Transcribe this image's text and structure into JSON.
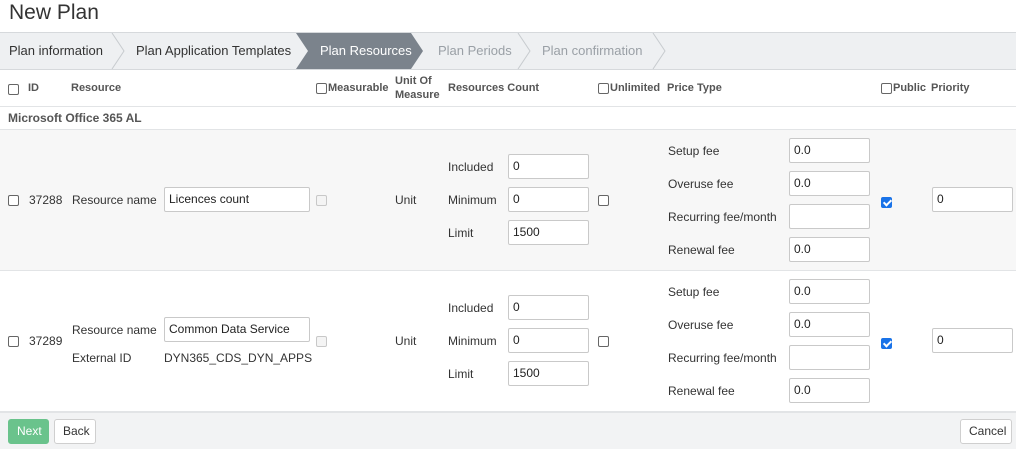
{
  "page": {
    "title": "New Plan"
  },
  "wizard": {
    "steps": [
      {
        "label": "Plan information",
        "state": "done"
      },
      {
        "label": "Plan Application Templates",
        "state": "done"
      },
      {
        "label": "Plan Resources",
        "state": "active"
      },
      {
        "label": "Plan Periods",
        "state": "future"
      },
      {
        "label": "Plan confirmation",
        "state": "future"
      }
    ]
  },
  "table": {
    "headers": {
      "id": "ID",
      "resource": "Resource",
      "measurable": "Measurable",
      "unit_of_measure_line1": "Unit Of",
      "unit_of_measure_line2": "Measure",
      "resources_count": "Resources Count",
      "unlimited": "Unlimited",
      "price_type": "Price Type",
      "public": "Public",
      "priority": "Priority"
    },
    "group": "Microsoft Office 365 AL",
    "rows": [
      {
        "id": "37288",
        "resource_label": "Resource name",
        "resource_name": "Licences count",
        "unit": "Unit",
        "count_labels": {
          "included": "Included",
          "minimum": "Minimum",
          "limit": "Limit"
        },
        "included": "0",
        "minimum": "0",
        "limit": "1500",
        "fee_labels": {
          "setup": "Setup fee",
          "overuse": "Overuse fee",
          "recurring": "Recurring fee/month",
          "renewal": "Renewal fee"
        },
        "setup_fee": "0.0",
        "overuse_fee": "0.0",
        "recurring_fee": "",
        "renewal_fee": "0.0",
        "public_checked": true,
        "priority": "0"
      },
      {
        "id": "37289",
        "resource_label": "Resource name",
        "resource_name": "Common Data Service",
        "external_id_label": "External ID",
        "external_id": "DYN365_CDS_DYN_APPS",
        "unit": "Unit",
        "count_labels": {
          "included": "Included",
          "minimum": "Minimum",
          "limit": "Limit"
        },
        "included": "0",
        "minimum": "0",
        "limit": "1500",
        "fee_labels": {
          "setup": "Setup fee",
          "overuse": "Overuse fee",
          "recurring": "Recurring fee/month",
          "renewal": "Renewal fee"
        },
        "setup_fee": "0.0",
        "overuse_fee": "0.0",
        "recurring_fee": "",
        "renewal_fee": "0.0",
        "public_checked": true,
        "priority": "0"
      }
    ]
  },
  "footer": {
    "next": "Next",
    "back": "Back",
    "cancel": "Cancel"
  },
  "colors": {
    "accent": "#6ac38c",
    "active_step": "#7b838c",
    "checkbox_checked": "#1a73e8"
  }
}
